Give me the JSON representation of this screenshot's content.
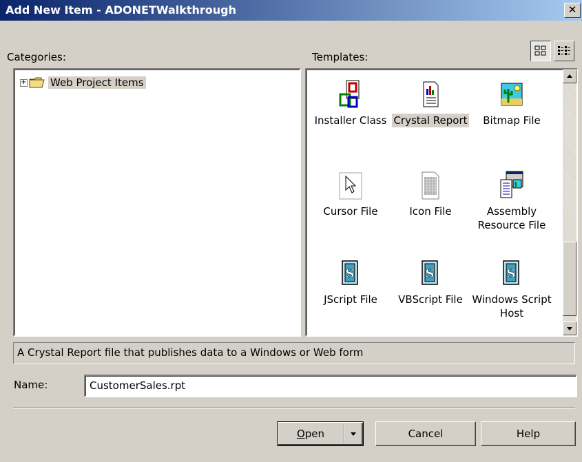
{
  "window": {
    "title": "Add New Item - ADONETWalkthrough",
    "close_glyph": "✕"
  },
  "categories": {
    "label": "Categories:",
    "items": [
      {
        "label": "Web Project Items",
        "icon": "folder-icon",
        "expander": "+"
      }
    ]
  },
  "templates": {
    "label": "Templates:",
    "view_buttons": [
      "large-icons-view-icon",
      "small-icons-view-icon"
    ],
    "items": [
      {
        "label": "Installer Class",
        "icon": "installer-class-icon",
        "selected": false
      },
      {
        "label": "Crystal Report",
        "icon": "crystal-report-icon",
        "selected": true
      },
      {
        "label": "Bitmap File",
        "icon": "bitmap-file-icon",
        "selected": false
      },
      {
        "label": "Cursor File",
        "icon": "cursor-file-icon",
        "selected": false
      },
      {
        "label": "Icon File",
        "icon": "icon-file-icon",
        "selected": false
      },
      {
        "label": "Assembly Resource File",
        "icon": "assembly-resource-file-icon",
        "selected": false
      },
      {
        "label": "JScript File",
        "icon": "script-file-icon",
        "selected": false
      },
      {
        "label": "VBScript File",
        "icon": "script-file-icon",
        "selected": false
      },
      {
        "label": "Windows Script Host",
        "icon": "script-file-icon",
        "selected": false
      }
    ]
  },
  "description": "A Crystal Report file that publishes data to a Windows or Web form",
  "name_field": {
    "label": "Name:",
    "value": "CustomerSales.rpt"
  },
  "buttons": {
    "open": "Open",
    "open_mnemonic": "O",
    "open_rest": "pen",
    "cancel": "Cancel",
    "help": "Help"
  },
  "colors": {
    "title_start": "#0a246a",
    "title_end": "#a6caf0",
    "face": "#d4d0c8"
  }
}
